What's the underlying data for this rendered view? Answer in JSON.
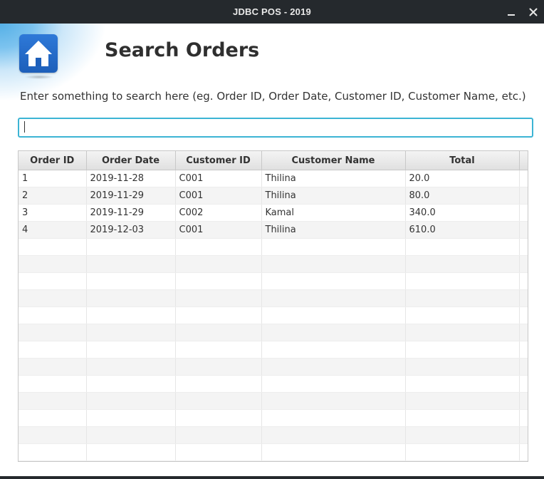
{
  "window": {
    "title": "JDBC POS - 2019",
    "minimize_icon": "minimize-icon",
    "close_icon": "close-icon"
  },
  "header": {
    "home_icon": "home-icon",
    "title": "Search Orders"
  },
  "search": {
    "label": "Enter something to search here (eg. Order ID, Order Date, Customer ID, Customer Name, etc.)",
    "value": "",
    "placeholder": ""
  },
  "table": {
    "columns": [
      "Order ID",
      "Order Date",
      "Customer ID",
      "Customer Name",
      "Total"
    ],
    "rows": [
      [
        "1",
        "2019-11-28",
        "C001",
        "Thilina",
        "20.0"
      ],
      [
        "2",
        "2019-11-29",
        "C001",
        "Thilina",
        "80.0"
      ],
      [
        "3",
        "2019-11-29",
        "C002",
        "Kamal",
        "340.0"
      ],
      [
        "4",
        "2019-12-03",
        "C001",
        "Thilina",
        "610.0"
      ]
    ]
  },
  "colors": {
    "titlebar": "#25292d",
    "accent_focus": "#3cb4d4",
    "home_button": "#2e79d8"
  }
}
